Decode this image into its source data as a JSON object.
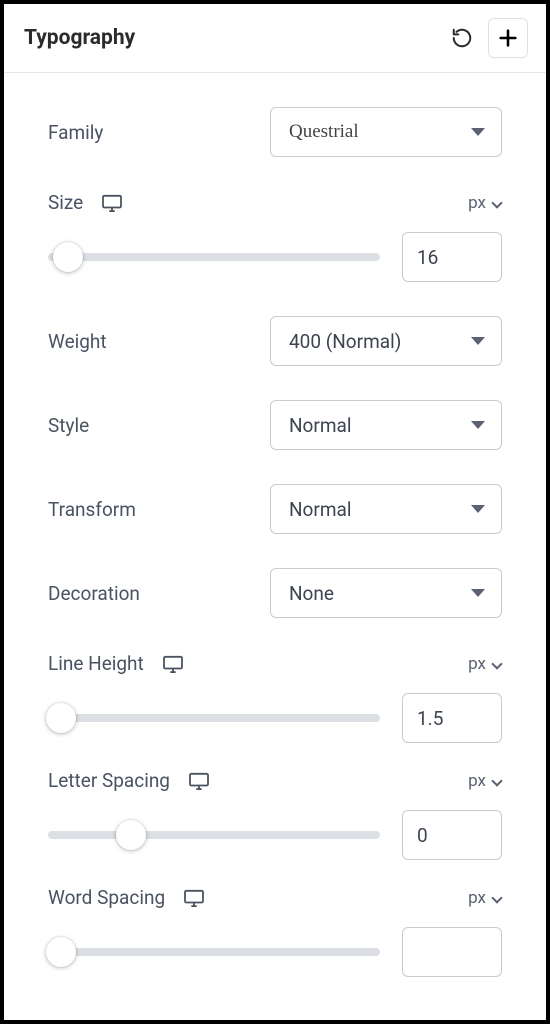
{
  "header": {
    "title": "Typography"
  },
  "family": {
    "label": "Family",
    "value": "Questrial"
  },
  "size": {
    "label": "Size",
    "unit": "px",
    "value": "16",
    "thumb_pct": 6
  },
  "weight": {
    "label": "Weight",
    "value": "400 (Normal)"
  },
  "style": {
    "label": "Style",
    "value": "Normal"
  },
  "transform": {
    "label": "Transform",
    "value": "Normal"
  },
  "decoration": {
    "label": "Decoration",
    "value": "None"
  },
  "line_height": {
    "label": "Line Height",
    "unit": "px",
    "value": "1.5",
    "thumb_pct": 4
  },
  "letter_spacing": {
    "label": "Letter Spacing",
    "unit": "px",
    "value": "0",
    "thumb_pct": 25
  },
  "word_spacing": {
    "label": "Word Spacing",
    "unit": "px",
    "value": "",
    "thumb_pct": 4
  }
}
